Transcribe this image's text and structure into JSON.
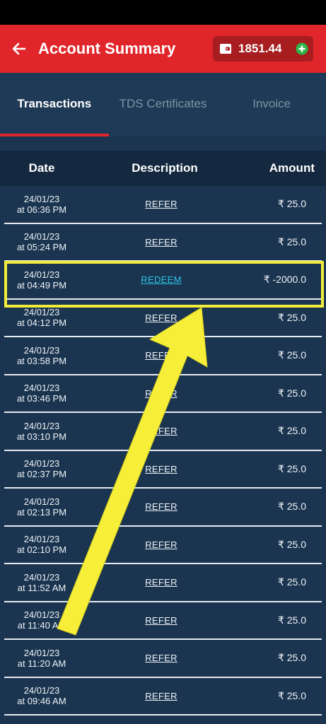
{
  "header": {
    "title": "Account Summary",
    "wallet_balance": "1851.44"
  },
  "tabs": [
    {
      "label": "Transactions",
      "active": true
    },
    {
      "label": "TDS Certificates",
      "active": false
    },
    {
      "label": "Invoice",
      "active": false
    }
  ],
  "table": {
    "columns": [
      "Date",
      "Description",
      "Amount"
    ],
    "rows": [
      {
        "date": "24/01/23",
        "time": "at 06:36 PM",
        "description": "REFER",
        "amount": "₹ 25.0"
      },
      {
        "date": "24/01/23",
        "time": "at 05:24 PM",
        "description": "REFER",
        "amount": "₹ 25.0"
      },
      {
        "date": "24/01/23",
        "time": "at 04:49 PM",
        "description": "REDEEM",
        "amount": "₹ -2000.0"
      },
      {
        "date": "24/01/23",
        "time": "at 04:12 PM",
        "description": "REFER",
        "amount": "₹ 25.0"
      },
      {
        "date": "24/01/23",
        "time": "at 03:58 PM",
        "description": "REFER",
        "amount": "₹ 25.0"
      },
      {
        "date": "24/01/23",
        "time": "at 03:46 PM",
        "description": "REFER",
        "amount": "₹ 25.0"
      },
      {
        "date": "24/01/23",
        "time": "at 03:10 PM",
        "description": "REFER",
        "amount": "₹ 25.0"
      },
      {
        "date": "24/01/23",
        "time": "at 02:37 PM",
        "description": "REFER",
        "amount": "₹ 25.0"
      },
      {
        "date": "24/01/23",
        "time": "at 02:13 PM",
        "description": "REFER",
        "amount": "₹ 25.0"
      },
      {
        "date": "24/01/23",
        "time": "at 02:10 PM",
        "description": "REFER",
        "amount": "₹ 25.0"
      },
      {
        "date": "24/01/23",
        "time": "at 11:52 AM",
        "description": "REFER",
        "amount": "₹ 25.0"
      },
      {
        "date": "24/01/23",
        "time": "at 11:40 AM",
        "description": "REFER",
        "amount": "₹ 25.0"
      },
      {
        "date": "24/01/23",
        "time": "at 11:20 AM",
        "description": "REFER",
        "amount": "₹ 25.0"
      },
      {
        "date": "24/01/23",
        "time": "at 09:46 AM",
        "description": "REFER",
        "amount": "₹ 25.0"
      }
    ]
  },
  "colors": {
    "primary": "#e0262b",
    "background": "#1b3550",
    "highlight": "#f3ec3b",
    "link_active": "#2bc4e6",
    "add_green": "#2db34a"
  }
}
